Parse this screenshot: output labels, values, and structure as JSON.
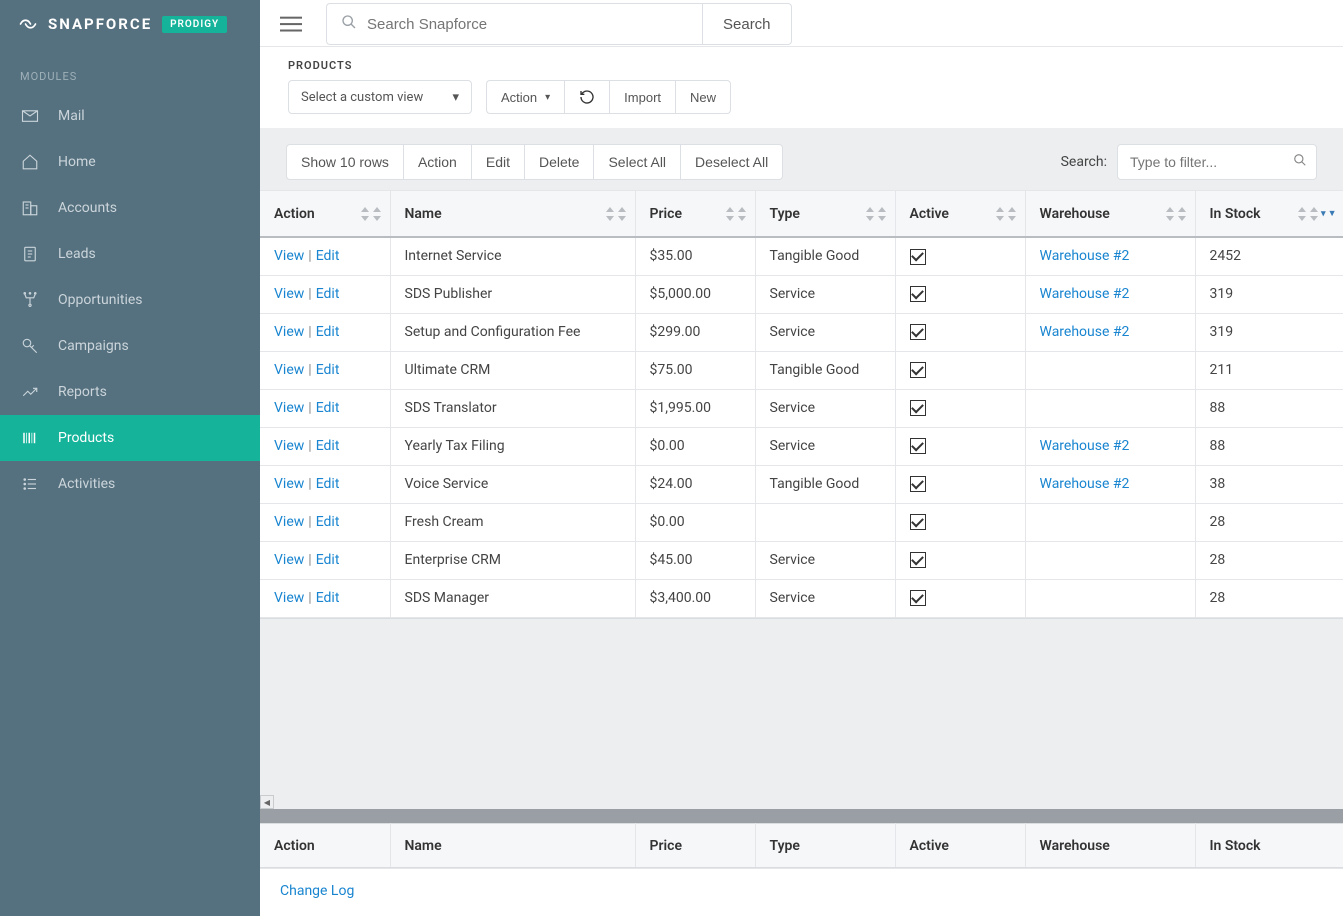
{
  "brand": {
    "name": "SNAPFORCE",
    "tag": "PRODIGY"
  },
  "section_label": "MODULES",
  "nav": [
    {
      "key": "mail",
      "label": "Mail"
    },
    {
      "key": "home",
      "label": "Home"
    },
    {
      "key": "accounts",
      "label": "Accounts"
    },
    {
      "key": "leads",
      "label": "Leads"
    },
    {
      "key": "opportunities",
      "label": "Opportunities"
    },
    {
      "key": "campaigns",
      "label": "Campaigns"
    },
    {
      "key": "reports",
      "label": "Reports"
    },
    {
      "key": "products",
      "label": "Products",
      "active": true
    },
    {
      "key": "activities",
      "label": "Activities"
    }
  ],
  "topbar": {
    "search_placeholder": "Search Snapforce",
    "search_button": "Search"
  },
  "page": {
    "title": "PRODUCTS",
    "select_view": "Select a custom view",
    "action_button": "Action",
    "import_button": "Import",
    "new_button": "New"
  },
  "table_toolbar": {
    "buttons": [
      "Show 10 rows",
      "Action",
      "Edit",
      "Delete",
      "Select All",
      "Deselect All"
    ],
    "search_label": "Search:",
    "filter_placeholder": "Type to filter..."
  },
  "columns": [
    "Action",
    "Name",
    "Price",
    "Type",
    "Active",
    "Warehouse",
    "In Stock"
  ],
  "column_footer": [
    "Action",
    "Name",
    "Price",
    "Type",
    "Active",
    "Warehouse",
    "In Stock"
  ],
  "row_actions": {
    "view": "View",
    "edit": "Edit"
  },
  "rows": [
    {
      "name": "Internet Service",
      "price": "$35.00",
      "type": "Tangible Good",
      "active": true,
      "warehouse": "Warehouse #2",
      "stock": "2452"
    },
    {
      "name": "SDS Publisher",
      "price": "$5,000.00",
      "type": "Service",
      "active": true,
      "warehouse": "Warehouse #2",
      "stock": "319"
    },
    {
      "name": "Setup and Configuration Fee",
      "price": "$299.00",
      "type": "Service",
      "active": true,
      "warehouse": "Warehouse #2",
      "stock": "319"
    },
    {
      "name": "Ultimate CRM",
      "price": "$75.00",
      "type": "Tangible Good",
      "active": true,
      "warehouse": "",
      "stock": "211"
    },
    {
      "name": "SDS Translator",
      "price": "$1,995.00",
      "type": "Service",
      "active": true,
      "warehouse": "",
      "stock": "88"
    },
    {
      "name": "Yearly Tax Filing",
      "price": "$0.00",
      "type": "Service",
      "active": true,
      "warehouse": "Warehouse #2",
      "stock": "88"
    },
    {
      "name": "Voice Service",
      "price": "$24.00",
      "type": "Tangible Good",
      "active": true,
      "warehouse": "Warehouse #2",
      "stock": "38"
    },
    {
      "name": "Fresh Cream",
      "price": "$0.00",
      "type": "",
      "active": true,
      "warehouse": "",
      "stock": "28"
    },
    {
      "name": "Enterprise CRM",
      "price": "$45.00",
      "type": "Service",
      "active": true,
      "warehouse": "",
      "stock": "28"
    },
    {
      "name": "SDS Manager",
      "price": "$3,400.00",
      "type": "Service",
      "active": true,
      "warehouse": "",
      "stock": "28"
    }
  ],
  "footer": {
    "change_log": "Change Log"
  }
}
